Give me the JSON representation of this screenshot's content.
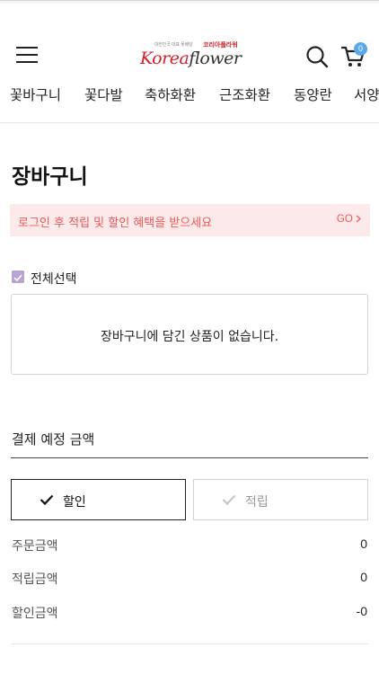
{
  "header": {
    "logo": {
      "tagline": "대한민국 대표 꽃배달",
      "korean_name": "코리아플라워",
      "brand_korea": "Korea",
      "brand_flower": "flower",
      "brand_color": "#d41f26"
    },
    "cart_count": "0",
    "icons": [
      "menu-icon",
      "search-icon",
      "cart-icon"
    ]
  },
  "categories": [
    "꽃바구니",
    "꽃다발",
    "축하화환",
    "근조화환",
    "동양란",
    "서양란"
  ],
  "page_title": "장바구니",
  "login_banner": {
    "message": "로그인 후 적립 및 할인 혜택을 받으세요",
    "go_label": "GO",
    "color": "#e85a5a",
    "background": "#fce9ea"
  },
  "select_all": {
    "label": "전체선택",
    "checked": true
  },
  "cart_empty_message": "장바구니에 담긴 상품이 없습니다.",
  "payment": {
    "title": "결제 예정 금액",
    "tabs": [
      {
        "label": "할인",
        "active": true
      },
      {
        "label": "적립",
        "active": false
      }
    ],
    "rows": [
      {
        "label": "주문금액",
        "value": "0"
      },
      {
        "label": "적립금액",
        "value": "0"
      },
      {
        "label": "할인금액",
        "value": "-0"
      }
    ]
  }
}
